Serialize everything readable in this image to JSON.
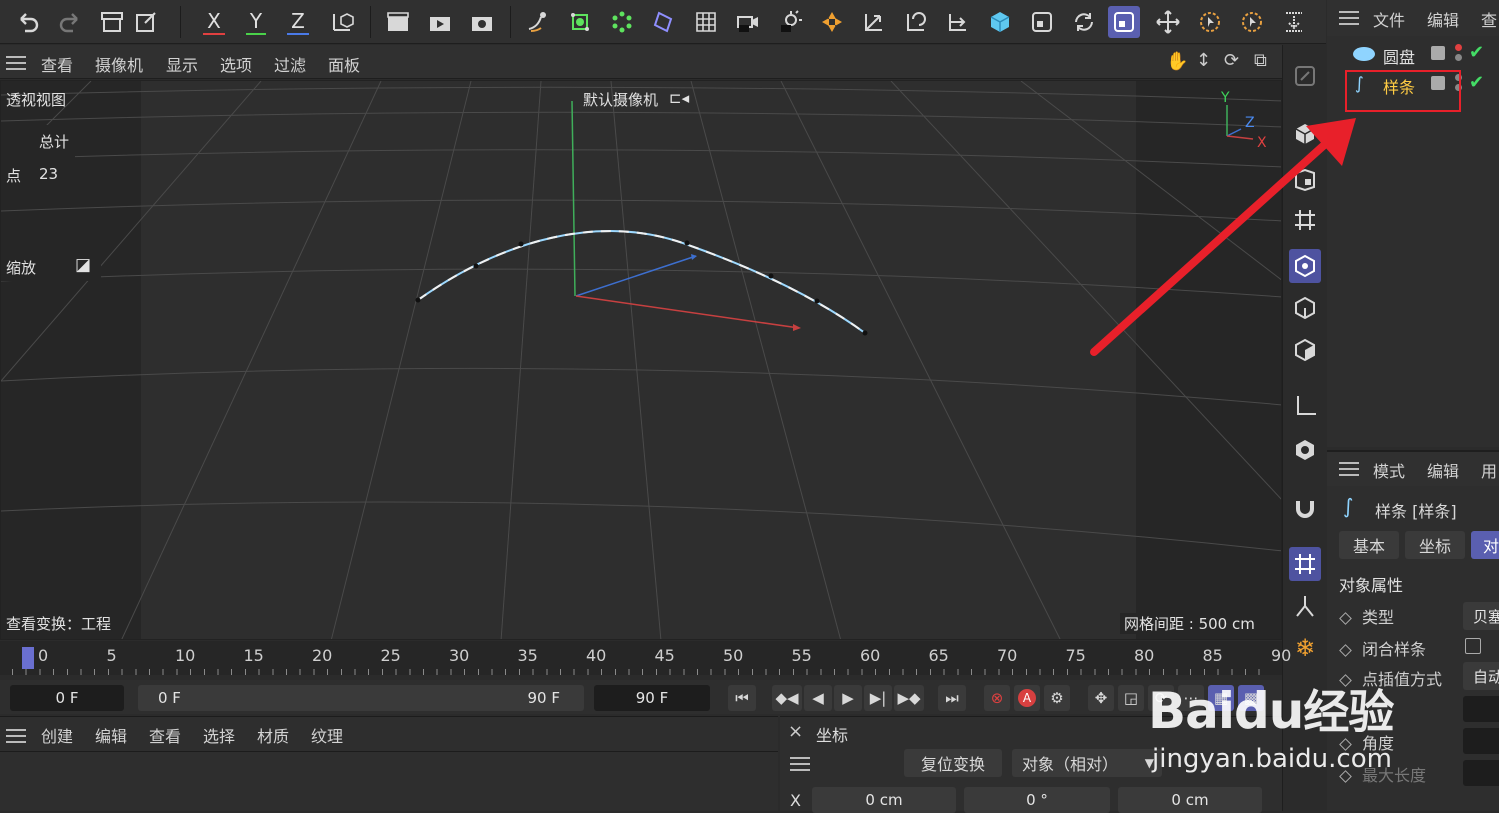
{
  "toolbar": {
    "axis_x": "X",
    "axis_y": "Y",
    "axis_z": "Z"
  },
  "viewport_menu": {
    "items": [
      "查看",
      "摄像机",
      "显示",
      "选项",
      "过滤",
      "面板"
    ]
  },
  "viewport": {
    "view_name": "透视视图",
    "camera_label": "默认摄像机",
    "stats_header": "总计",
    "stats_points_label": "点",
    "stats_points_value": "23",
    "zoom_label": "缩放",
    "view_transform": "查看变换：工程",
    "grid_spacing": "网格间距 : 500 cm",
    "axis_labels": {
      "y": "Y",
      "z": "Z",
      "x": "X"
    }
  },
  "object_manager": {
    "menu": [
      "文件",
      "编辑",
      "查"
    ],
    "objects": [
      {
        "name": "圆盘",
        "icon": "disc-icon"
      },
      {
        "name": "样条",
        "icon": "spline-icon"
      }
    ]
  },
  "attribute_manager": {
    "menu": [
      "模式",
      "编辑",
      "用"
    ],
    "object_title": "样条 [样条]",
    "tabs": [
      "基本",
      "坐标",
      "对"
    ],
    "section_title": "对象属性",
    "props": [
      {
        "label": "类型",
        "value": "贝塞"
      },
      {
        "label": "闭合样条",
        "value": ""
      },
      {
        "label": "点插值方式",
        "value": "自动"
      },
      {
        "label": "",
        "value": ""
      },
      {
        "label": "角度",
        "value": ""
      },
      {
        "label": "最大长度",
        "value": ""
      }
    ]
  },
  "timeline": {
    "ticks": [
      "0",
      "5",
      "10",
      "15",
      "20",
      "25",
      "30",
      "35",
      "40",
      "45",
      "50",
      "55",
      "60",
      "65",
      "70",
      "75",
      "80",
      "85",
      "90"
    ],
    "current_frame": 0
  },
  "transport": {
    "current_frame": "0 F",
    "range_start": "0 F",
    "range_end": "90 F",
    "end_frame": "90 F"
  },
  "material_manager": {
    "menu": [
      "创建",
      "编辑",
      "查看",
      "选择",
      "材质",
      "纹理"
    ]
  },
  "coordinates": {
    "title": "坐标",
    "reset_button": "复位变换",
    "mode": "对象（相对）",
    "row_label": "X",
    "values": [
      "0 cm",
      "0 °",
      "0 cm"
    ]
  },
  "watermark": {
    "brand": "Baidu",
    "suffix": "经验",
    "url": "jingyan.baidu.com"
  },
  "colors": {
    "accent": "#5a5fb0",
    "annotation_red": "#e8202a",
    "spline_blue": "#8fd4ff",
    "check_green": "#44dd66",
    "highlight_yellow": "#ffcc44"
  }
}
